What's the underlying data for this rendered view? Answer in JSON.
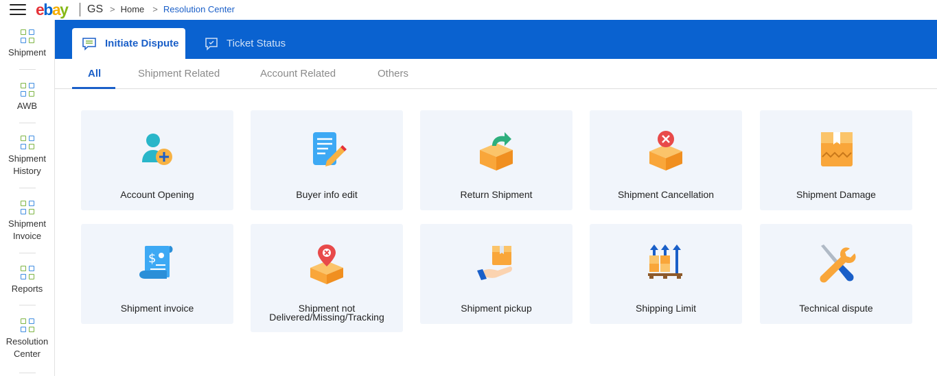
{
  "topbar": {
    "logo_letters": [
      "e",
      "b",
      "a",
      "y"
    ],
    "workspace": "GS",
    "breadcrumb": {
      "home": "Home",
      "current": "Resolution Center",
      "separator": ">"
    }
  },
  "sidebar": {
    "items": [
      {
        "label": "Shipment"
      },
      {
        "label": "AWB"
      },
      {
        "label": "Shipment History"
      },
      {
        "label": "Shipment Invoice"
      },
      {
        "label": "Reports"
      },
      {
        "label": "Resolution Center"
      }
    ]
  },
  "main_tabs": [
    {
      "label": "Initiate Dispute",
      "active": true,
      "icon": "chat-list-icon"
    },
    {
      "label": "Ticket Status",
      "active": false,
      "icon": "chat-check-icon"
    }
  ],
  "sub_tabs": [
    {
      "label": "All",
      "active": true
    },
    {
      "label": "Shipment Related"
    },
    {
      "label": "Account Related"
    },
    {
      "label": "Others"
    }
  ],
  "cards": [
    {
      "title": "Account Opening",
      "icon": "add-user-icon"
    },
    {
      "title": "Buyer info edit",
      "icon": "edit-document-icon"
    },
    {
      "title": "Return Shipment",
      "icon": "return-box-icon"
    },
    {
      "title": "Shipment Cancellation",
      "icon": "cancel-box-icon"
    },
    {
      "title": "Shipment Damage",
      "icon": "damaged-box-icon"
    },
    {
      "title": "Shipment invoice",
      "icon": "invoice-icon"
    },
    {
      "title": "Shipment not Delivered/Missing/Tracking",
      "title_line1": "Shipment not",
      "title_line2": "Delivered/Missing/Tracking",
      "icon": "missing-box-icon"
    },
    {
      "title": "Shipment pickup",
      "icon": "pickup-hand-icon"
    },
    {
      "title": "Shipping Limit",
      "icon": "shipping-limit-icon"
    },
    {
      "title": "Technical dispute",
      "icon": "tools-icon"
    }
  ],
  "colors": {
    "brand_blue": "#0a62d0",
    "link_blue": "#1a5fc8",
    "card_bg": "#f1f5fb",
    "box_orange": "#f9a63a",
    "icon_green": "#7cb342"
  }
}
